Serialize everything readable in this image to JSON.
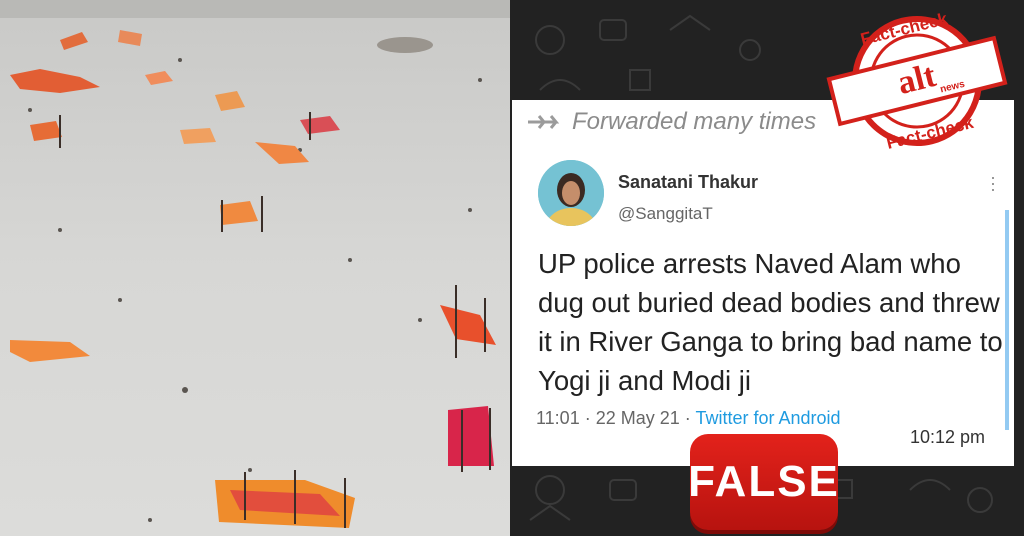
{
  "forward": {
    "label": "Forwarded many times"
  },
  "tweet": {
    "author_name": "Sanatani Thakur",
    "handle": "@SanggitaT",
    "text": "UP police arrests Naved Alam who dug out buried dead bodies and threw it in River Ganga to bring bad name to Yogi ji and Modi ji",
    "timestamp": "11:01 · 22 May 21 · ",
    "source": "Twitter for Android"
  },
  "message": {
    "time": "10:12 pm"
  },
  "verdict": {
    "label": "FALSE",
    "color": "#d81b14"
  },
  "stamp": {
    "top_text": "Fact-check",
    "bottom_text": "Fact-check",
    "logo_text": "alt",
    "logo_sub": "news"
  },
  "colors": {
    "stamp_red": "#d3211b",
    "link_blue": "#1f9be0"
  }
}
